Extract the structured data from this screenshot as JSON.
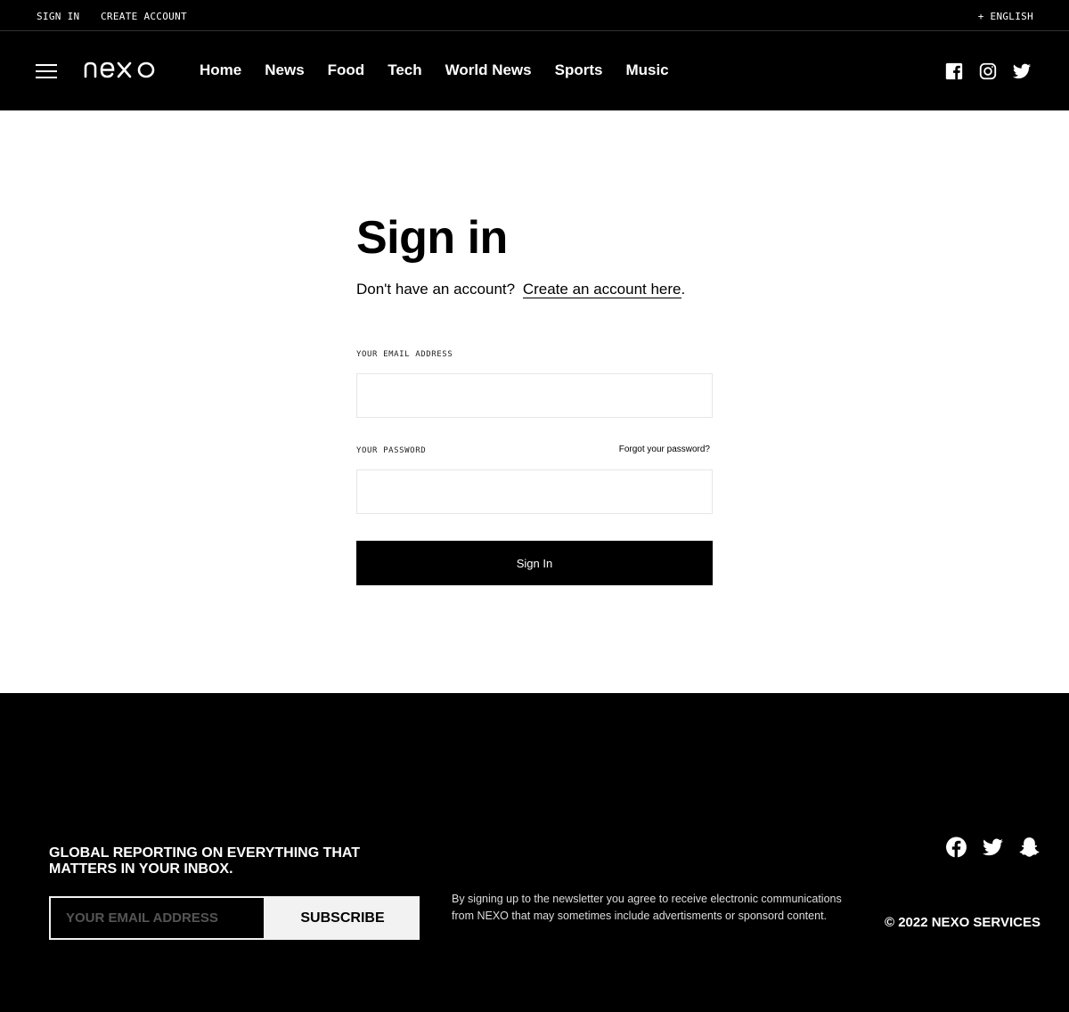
{
  "topbar": {
    "sign_in": "SIGN IN",
    "create_account": "CREATE ACCOUNT",
    "language": "+ ENGLISH"
  },
  "nav": {
    "logo": "nexo",
    "links": [
      "Home",
      "News",
      "Food",
      "Tech",
      "World News",
      "Sports",
      "Music"
    ],
    "social_icons": [
      "facebook-icon",
      "instagram-icon",
      "twitter-icon"
    ]
  },
  "signin": {
    "title": "Sign in",
    "no_account": "Don't have an account?",
    "create_link": "Create an account here",
    "period": ".",
    "email_label": "YOUR EMAIL ADDRESS",
    "email_value": "",
    "password_label": "YOUR PASSWORD",
    "password_value": "",
    "forgot": "Forgot your password?",
    "submit": "Sign In"
  },
  "footer": {
    "headline": "GLOBAL REPORTING ON EVERYTHING THAT MATTERS IN YOUR INBOX.",
    "email_placeholder": "YOUR EMAIL ADDRESS",
    "subscribe": "SUBSCRIBE",
    "note": "By signing up to the newsletter you agree to receive electronic communications from NEXO that may sometimes include advertisments or sponsord content.",
    "social_icons": [
      "facebook-icon",
      "twitter-icon",
      "snapchat-icon"
    ],
    "copyright": "© 2022 NEXO SERVICES"
  },
  "colors": {
    "background": "#ffffff",
    "header": "#000000",
    "footer": "#000000",
    "input_border": "#e6e6e6",
    "button": "#000000",
    "footer_button": "#f2f2f2"
  }
}
